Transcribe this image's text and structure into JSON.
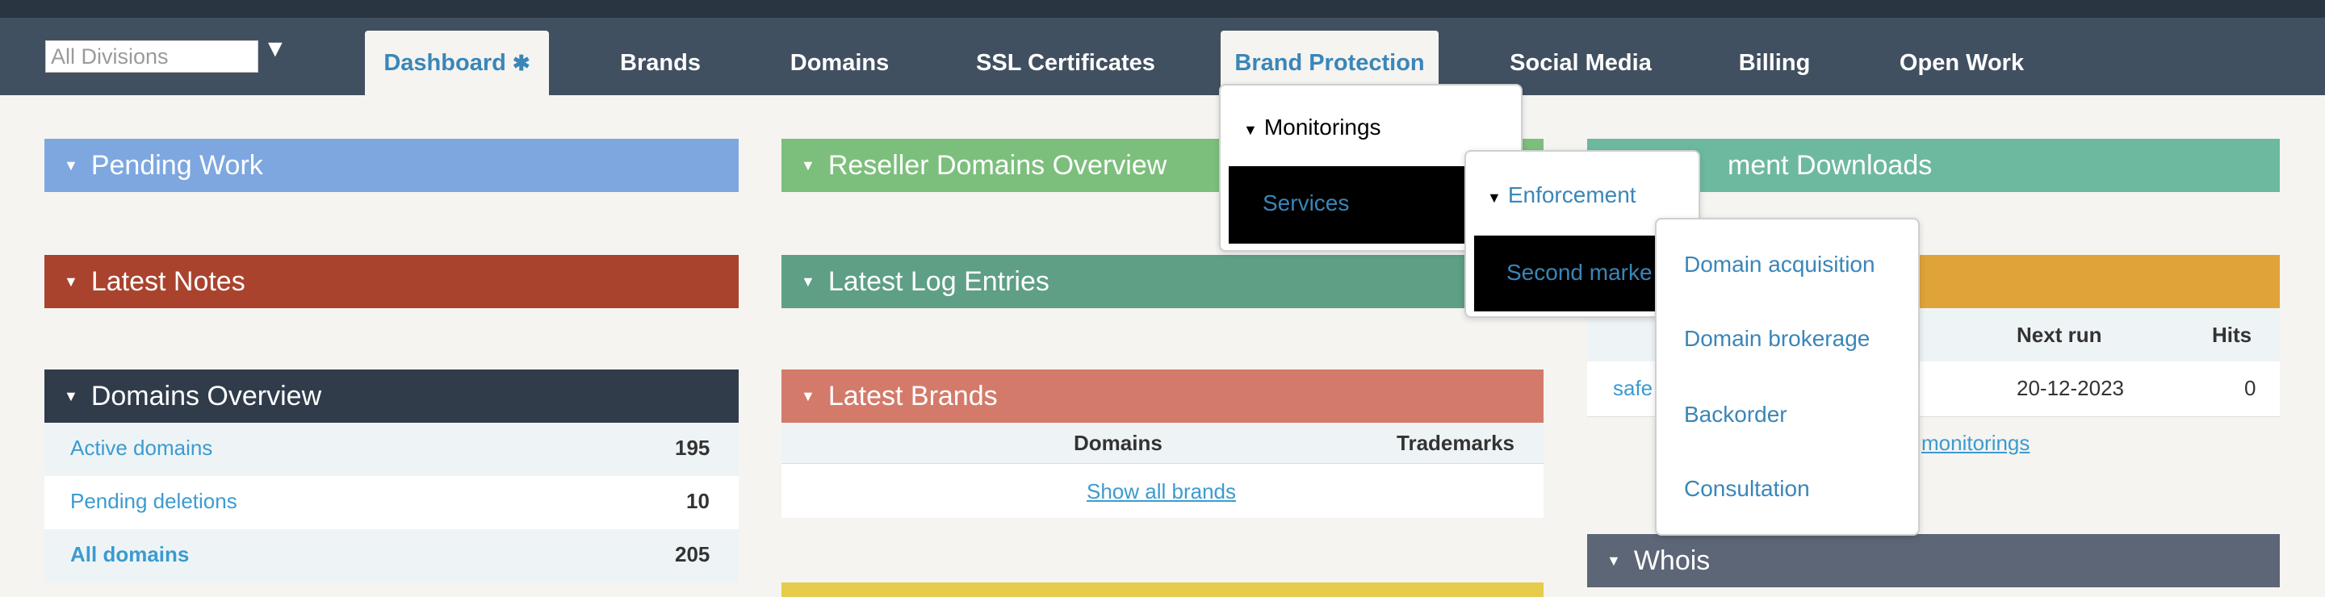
{
  "nav": {
    "division_select": "All Divisions",
    "tabs": [
      {
        "label": "Dashboard"
      },
      {
        "label": "Brands"
      },
      {
        "label": "Domains"
      },
      {
        "label": "SSL Certificates"
      },
      {
        "label": "Brand Protection"
      },
      {
        "label": "Social Media"
      },
      {
        "label": "Billing"
      },
      {
        "label": "Open Work"
      }
    ]
  },
  "panels": {
    "pending_work": "Pending Work",
    "latest_notes": "Latest Notes",
    "domains_overview": "Domains Overview",
    "reseller_domains_overview": "Reseller Domains Overview",
    "latest_log_entries": "Latest Log Entries",
    "latest_brands": "Latest Brands",
    "document_downloads": "ment Downloads",
    "whois": "Whois"
  },
  "domains_overview": {
    "rows": [
      {
        "label": "Active domains",
        "value": "195"
      },
      {
        "label": "Pending deletions",
        "value": "10"
      },
      {
        "label": "All domains",
        "value": "205"
      }
    ]
  },
  "latest_brands": {
    "col_domains": "Domains",
    "col_trademarks": "Trademarks",
    "show_all": "Show all brands"
  },
  "monitorings_panel": {
    "col_next_run": "Next run",
    "col_hits": "Hits",
    "row_name": "safe",
    "row_next_run": "20-12-2023",
    "row_hits": "0",
    "link": "monitorings"
  },
  "menu": {
    "monitorings": "Monitorings",
    "services": "Services",
    "enforcement": "Enforcement",
    "second_market": "Second marke",
    "items": [
      "Domain acquisition",
      "Domain brokerage",
      "Backorder",
      "Consultation"
    ]
  },
  "colors": {
    "navbar": "#415060",
    "pending_work": "#7ea7e0",
    "latest_notes": "#a9432e",
    "domains_overview": "#313c4b",
    "reseller": "#7cbf7c",
    "log_entries": "#5e9f86",
    "latest_brands": "#d47a6a",
    "downloads": "#6db99f",
    "orange_panel": "#e0a33a",
    "whois": "#5c6676",
    "yellow_panel": "#e6cc4a"
  }
}
